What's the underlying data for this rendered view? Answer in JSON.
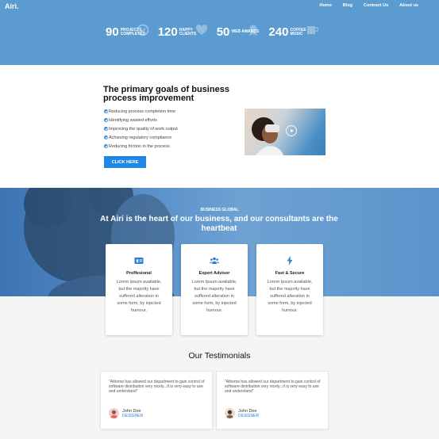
{
  "brand": {
    "logo": "Airi."
  },
  "nav": [
    "Home",
    "Blog",
    "Contract Us",
    "About us"
  ],
  "stats": [
    {
      "number": "90",
      "label": "Projects Completed",
      "icon": "check-circle-icon"
    },
    {
      "number": "120",
      "label": "Happy Clients",
      "icon": "heart-icon"
    },
    {
      "number": "50",
      "label": "WEB AWARDS",
      "icon": "award-icon"
    },
    {
      "number": "240",
      "label": "Coffee Music",
      "icon": "music-icon"
    }
  ],
  "goals": {
    "title": "The primary goals of business process improvement",
    "items": [
      "Reducing process completion time",
      "Identifying wasted efforts",
      "Improving the quality of work output",
      "Achieving regulatory compliance",
      "Reducing friction in the process"
    ],
    "button": "CLICK HERE"
  },
  "band": {
    "kicker": "BUSINESS GLOBAL",
    "title": "At Airi is the heart of our business, and our consultants are the heartbeat"
  },
  "features": [
    {
      "title": "Proffesional",
      "text": "Lorem Ipsum available, but the majority have suffered alteration in some form, by injected humour.",
      "icon": "id-card-icon"
    },
    {
      "title": "Expert Advisor",
      "text": "Lorem Ipsum available, but the majority have suffered alteration in some form, by injected humour.",
      "icon": "users-icon"
    },
    {
      "title": "Fast & Secure",
      "text": "Lorem Ipsum available, but the majority have suffered alteration in some form, by injected humour.",
      "icon": "bolt-icon"
    }
  ],
  "testimonials": {
    "title": "Our Testimonials",
    "items": [
      {
        "quote": "\"Atheme has allowed our department to gain control of software distribution very nicely...It is very easy to use and understand\"",
        "name": "John Doe",
        "role": "DESIGNER"
      },
      {
        "quote": "\"Atheme has allowed our department to gain control of software distribution very nicely...It is very easy to use and understand\"",
        "name": "John Doe",
        "role": "DESIGNER"
      }
    ]
  },
  "colors": {
    "accent": "#1e88e5",
    "header": "#5b9bd0"
  }
}
